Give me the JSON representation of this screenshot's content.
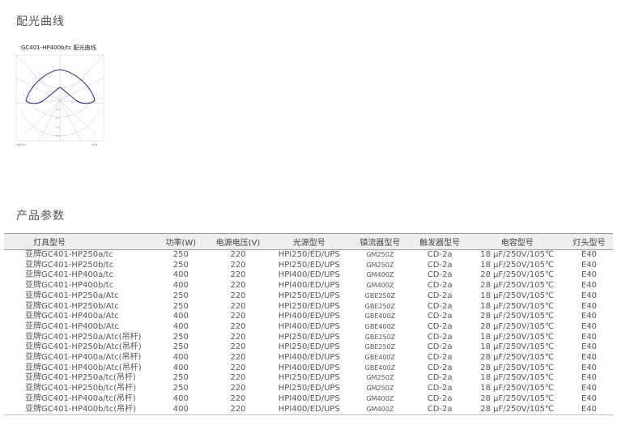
{
  "sections": {
    "curve_title": "配光曲线",
    "params_title": "产品参数"
  },
  "curve": {
    "label": "GC401-HP400b/tc 配光曲线",
    "bottom_left": "cd/klm",
    "bottom_right": "Unit"
  },
  "table": {
    "headers": [
      "灯具型号",
      "功率(W)",
      "电源电压(V)",
      "光源型号",
      "镇流器型号",
      "触发器型号",
      "电容型号",
      "灯头型号"
    ],
    "rows": [
      [
        "亚牌GC401-HP250a/tc",
        "250",
        "220",
        "HPI250/ED/UPS",
        "GM250Z",
        "CD-2a",
        "18 μF/250V/105℃",
        "E40"
      ],
      [
        "亚牌GC401-HP250b/tc",
        "250",
        "220",
        "HPI250/ED/UPS",
        "GM250Z",
        "CD-2a",
        "18 μF/250V/105℃",
        "E40"
      ],
      [
        "亚牌GC401-HP400a/tc",
        "400",
        "220",
        "HPI400/ED/UPS",
        "GM400Z",
        "CD-2a",
        "28 μF/250V/105℃",
        "E40"
      ],
      [
        "亚牌GC401-HP400b/tc",
        "400",
        "220",
        "HPI400/ED/UPS",
        "GM400Z",
        "CD-2a",
        "28 μF/250V/105℃",
        "E40"
      ],
      [
        "亚牌GC401-HP250a/Atc",
        "250",
        "220",
        "HPI250/ED/UPS",
        "GBE250Z",
        "CD-2a",
        "18 μF/250V/105℃",
        "E40"
      ],
      [
        "亚牌GC401-HP250b/Atc",
        "250",
        "220",
        "HPI250/ED/UPS",
        "GBE250Z",
        "CD-2a",
        "18 μF/250V/105℃",
        "E40"
      ],
      [
        "亚牌GC401-HP400a/Atc",
        "400",
        "220",
        "HPI400/ED/UPS",
        "GBE400Z",
        "CD-2a",
        "28 μF/250V/105℃",
        "E40"
      ],
      [
        "亚牌GC401-HP400b/Atc",
        "400",
        "220",
        "HPI400/ED/UPS",
        "GBE400Z",
        "CD-2a",
        "28 μF/250V/105℃",
        "E40"
      ],
      [
        "亚牌GC401-HP250a/Atc(吊杆)",
        "250",
        "220",
        "HPI250/ED/UPS",
        "GBE250Z",
        "CD-2a",
        "18 μF/250V/105℃",
        "E40"
      ],
      [
        "亚牌GC401-HP250b/Atc(吊杆)",
        "250",
        "220",
        "HPI250/ED/UPS",
        "GBE250Z",
        "CD-2a",
        "18 μF/250V/105℃",
        "E40"
      ],
      [
        "亚牌GC401-HP400a/Atc(吊杆)",
        "400",
        "220",
        "HPI400/ED/UPS",
        "GBE400Z",
        "CD-2a",
        "28 μF/250V/105℃",
        "E40"
      ],
      [
        "亚牌GC401-HP400b/Atc(吊杆)",
        "400",
        "220",
        "HPI400/ED/UPS",
        "GBE400Z",
        "CD-2a",
        "28 μF/250V/105℃",
        "E40"
      ],
      [
        "亚牌GC401-HP250a/tc(吊杆)",
        "250",
        "220",
        "HPI250/ED/UPS",
        "GM250Z",
        "CD-2a",
        "18 μF/250V/105℃",
        "E40"
      ],
      [
        "亚牌GC401-HP250b/tc(吊杆)",
        "250",
        "220",
        "HPI250/ED/UPS",
        "GM250Z",
        "CD-2a",
        "18 μF/250V/105℃",
        "E40"
      ],
      [
        "亚牌GC401-HP400a/tc(吊杆)",
        "400",
        "220",
        "HPI400/ED/UPS",
        "GM400Z",
        "CD-2a",
        "28 μF/250V/105℃",
        "E40"
      ],
      [
        "亚牌GC401-HP400b/tc(吊杆)",
        "400",
        "220",
        "HPI400/ED/UPS",
        "GM400Z",
        "CD-2a",
        "28 μF/250V/105℃",
        "E40"
      ]
    ]
  },
  "colors": {
    "curve_line": "#2b2f9c",
    "header_bg": "#eeeeee"
  }
}
